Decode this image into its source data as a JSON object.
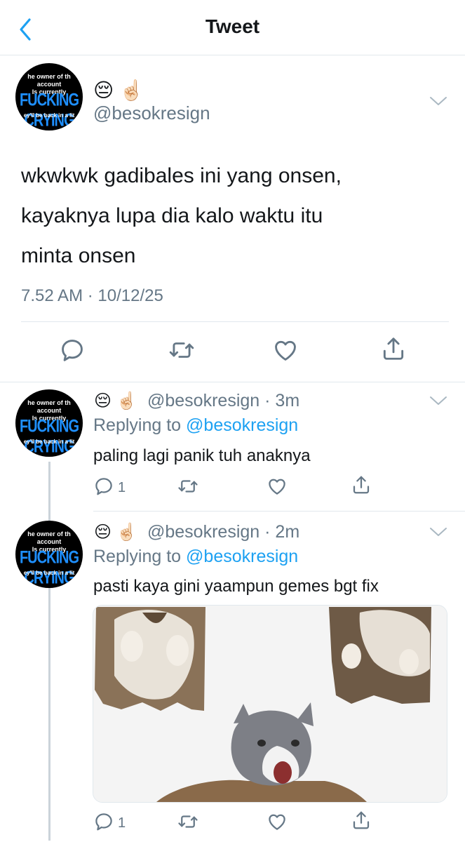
{
  "header": {
    "title": "Tweet"
  },
  "avatar": {
    "line1": "he owner of th",
    "line2": "account",
    "line3": "Is currently",
    "big": "FUCKING CRYING",
    "line4": "ey'll be back in a lit"
  },
  "main_tweet": {
    "emoji": "😔 ☝🏻",
    "handle": "@besokresign",
    "text_lines": [
      "wkwkwk gadibales ini yang onsen,",
      "kayaknya lupa dia kalo waktu itu",
      "minta onsen"
    ],
    "timestamp": "7.52 AM · 10/12/25",
    "actions": [
      "reply-icon",
      "retweet-icon",
      "like-icon",
      "share-icon"
    ]
  },
  "replies": [
    {
      "emoji": "😔 ☝🏻",
      "handle": "@besokresign",
      "time": "· 3m",
      "replying_prefix": "Replying to",
      "replying_handle": "@besokresign",
      "text": "paling lagi panik tuh anaknya",
      "reply_count": "1"
    },
    {
      "emoji": "😔 ☝🏻",
      "handle": "@besokresign",
      "time": "· 2m",
      "replying_prefix": "Replying to",
      "replying_handle": "@besokresign",
      "text": "pasti kaya gini yaampun gemes bgt fix",
      "reply_count": "1",
      "media": "cat-photo-collage"
    }
  ],
  "colors": {
    "link": "#1da1f2",
    "muted": "#657786",
    "divider": "#e1e8ed",
    "avatar_text_blue": "#1e8fff"
  }
}
